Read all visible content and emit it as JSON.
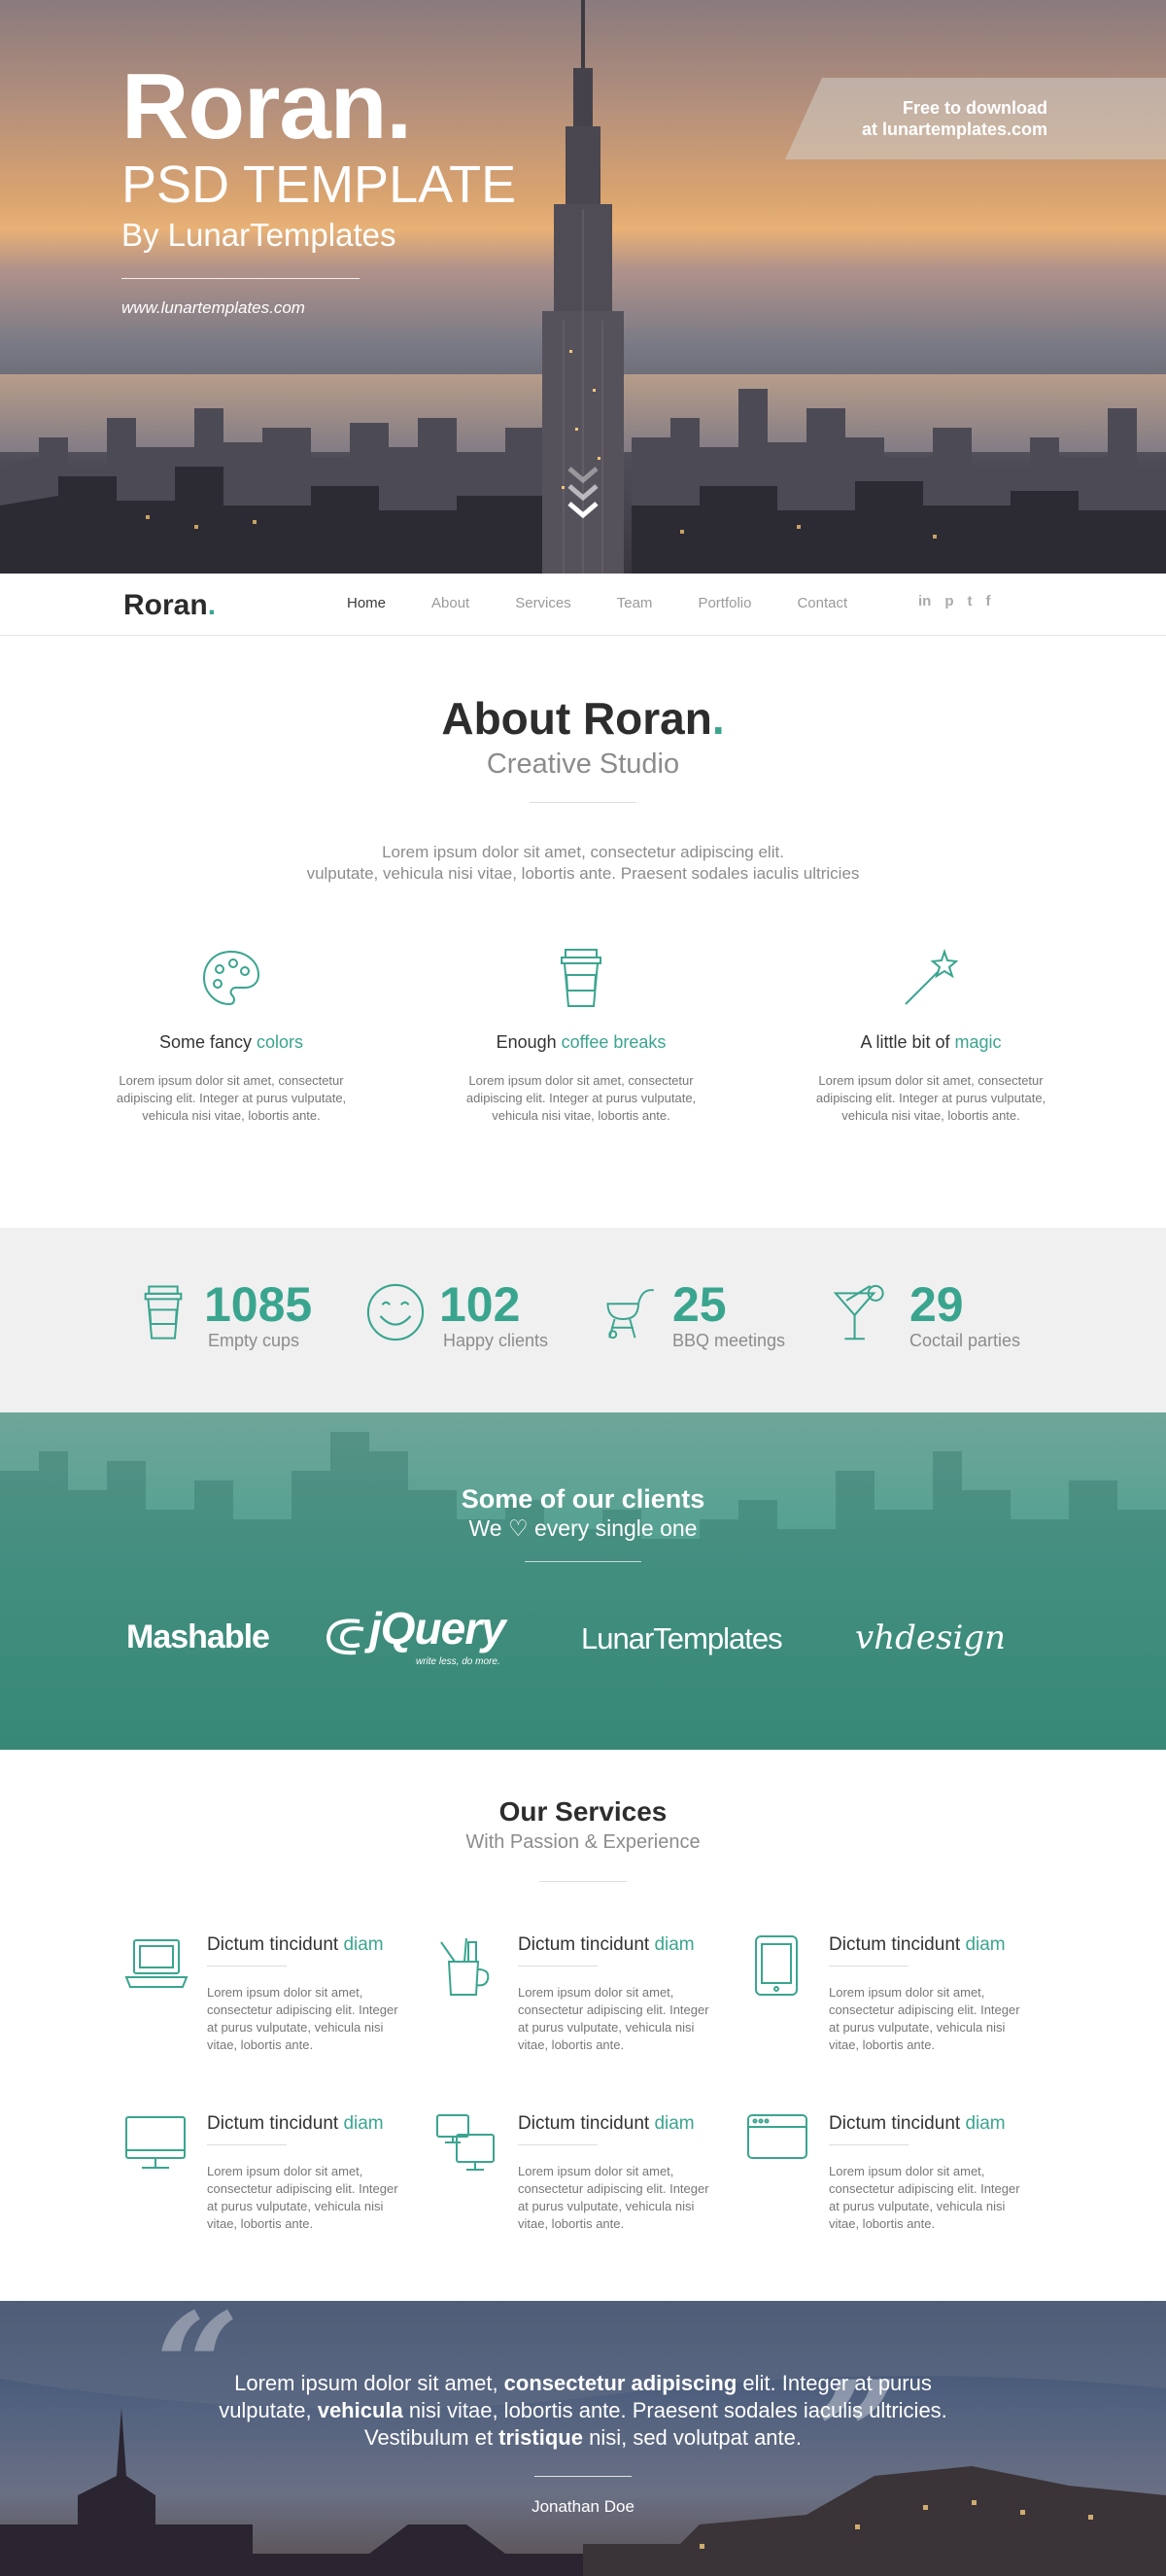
{
  "hero": {
    "brand": "Roran.",
    "subtitle": "PSD TEMPLATE",
    "byline": "By LunarTemplates",
    "url": "www.lunartemplates.com",
    "ribbon_line1": "Free to download",
    "ribbon_line2": "at lunartemplates.com"
  },
  "nav": {
    "logo": "Roran",
    "logo_dot": ".",
    "items": [
      "Home",
      "About",
      "Services",
      "Team",
      "Portfolio",
      "Contact"
    ],
    "social": [
      "in",
      "p",
      "t",
      "f"
    ]
  },
  "about": {
    "title": "About Roran",
    "title_dot": ".",
    "subtitle": "Creative Studio",
    "text_line1": "Lorem ipsum dolor sit amet, consectetur adipiscing elit.",
    "text_line2": "vulputate, vehicula nisi vitae, lobortis ante. Praesent sodales iaculis ultricies",
    "features": [
      {
        "prefix": "Some fancy ",
        "accent": "colors",
        "body": "Lorem ipsum dolor sit amet, consectetur adipiscing elit. Integer at purus vulputate, vehicula nisi vitae, lobortis ante.",
        "icon": "palette-icon"
      },
      {
        "prefix": "Enough ",
        "accent": "coffee breaks",
        "body": "Lorem ipsum dolor sit amet, consectetur adipiscing elit. Integer at purus vulputate, vehicula nisi vitae, lobortis ante.",
        "icon": "coffee-cup-icon"
      },
      {
        "prefix": "A little bit of ",
        "accent": "magic",
        "body": "Lorem ipsum dolor sit amet, consectetur adipiscing elit. Integer at purus vulputate, vehicula nisi vitae, lobortis ante.",
        "icon": "magic-wand-icon"
      }
    ]
  },
  "stats": [
    {
      "number": "1085",
      "label": "Empty cups",
      "icon": "coffee-cup-icon"
    },
    {
      "number": "102",
      "label": "Happy clients",
      "icon": "smiley-icon"
    },
    {
      "number": "25",
      "label": "BBQ meetings",
      "icon": "grill-icon"
    },
    {
      "number": "29",
      "label": "Coctail parties",
      "icon": "cocktail-icon"
    }
  ],
  "clients": {
    "title": "Some of our clients",
    "subtitle": "We ♡ every single one",
    "logos": [
      "Mashable",
      "jQuery",
      "write less, do more.",
      "LunarTemplates",
      "vhdesign"
    ]
  },
  "services": {
    "title": "Our Services",
    "subtitle": "With Passion & Experience",
    "items": [
      {
        "prefix": "Dictum tincidunt ",
        "accent": "diam",
        "body": "Lorem ipsum dolor sit amet, consectetur adipiscing elit. Integer at purus vulputate, vehicula nisi vitae, lobortis ante.",
        "icon": "laptop-icon"
      },
      {
        "prefix": "Dictum tincidunt ",
        "accent": "diam",
        "body": "Lorem ipsum dolor sit amet, consectetur adipiscing elit. Integer at purus vulputate, vehicula nisi vitae, lobortis ante.",
        "icon": "pencil-cup-icon"
      },
      {
        "prefix": "Dictum tincidunt ",
        "accent": "diam",
        "body": "Lorem ipsum dolor sit amet, consectetur adipiscing elit. Integer at purus vulputate, vehicula nisi vitae, lobortis ante.",
        "icon": "tablet-icon"
      },
      {
        "prefix": "Dictum tincidunt ",
        "accent": "diam",
        "body": "Lorem ipsum dolor sit amet, consectetur adipiscing elit. Integer at purus vulputate, vehicula nisi vitae, lobortis ante.",
        "icon": "monitor-icon"
      },
      {
        "prefix": "Dictum tincidunt ",
        "accent": "diam",
        "body": "Lorem ipsum dolor sit amet, consectetur adipiscing elit. Integer at purus vulputate, vehicula nisi vitae, lobortis ante.",
        "icon": "devices-icon"
      },
      {
        "prefix": "Dictum tincidunt ",
        "accent": "diam",
        "body": "Lorem ipsum dolor sit amet, consectetur adipiscing elit. Integer at purus vulputate, vehicula nisi vitae, lobortis ante.",
        "icon": "browser-window-icon"
      }
    ]
  },
  "quote": {
    "p1": "Lorem ipsum dolor sit amet, ",
    "b1": "consectetur adipiscing",
    "p2": " elit. Integer at purus vulputate, ",
    "b2": "vehicula",
    "p3": " nisi vitae, lobortis ante. Praesent sodales iaculis ultricies. Vestibulum et ",
    "b3": "tristique",
    "p4": " nisi, sed volutpat ante.",
    "author": "Jonathan Doe"
  },
  "colors": {
    "accent": "#3aa58f",
    "text": "#3a3a3a",
    "muted": "#8c8c8c",
    "stats_bg": "#f0f0f0"
  }
}
